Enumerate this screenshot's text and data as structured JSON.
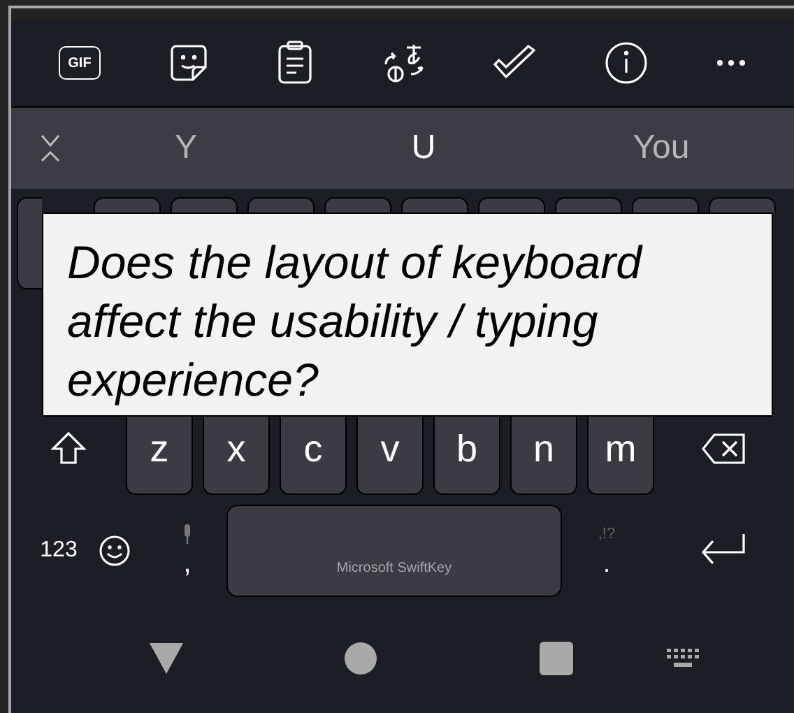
{
  "toolbar": {
    "gif_label": "GIF"
  },
  "suggestions": [
    {
      "text": "Y",
      "selected": false
    },
    {
      "text": "U",
      "selected": true
    },
    {
      "text": "You",
      "selected": false
    }
  ],
  "bottom_letters": [
    "z",
    "x",
    "c",
    "v",
    "b",
    "n",
    "m"
  ],
  "bottom_row": {
    "numbers_key": "123",
    "comma": ",",
    "space_label": "Microsoft SwiftKey",
    "period_hint": ",!?",
    "period": "."
  },
  "question": "Does the layout of keyboard affect the usability / typing experience?"
}
